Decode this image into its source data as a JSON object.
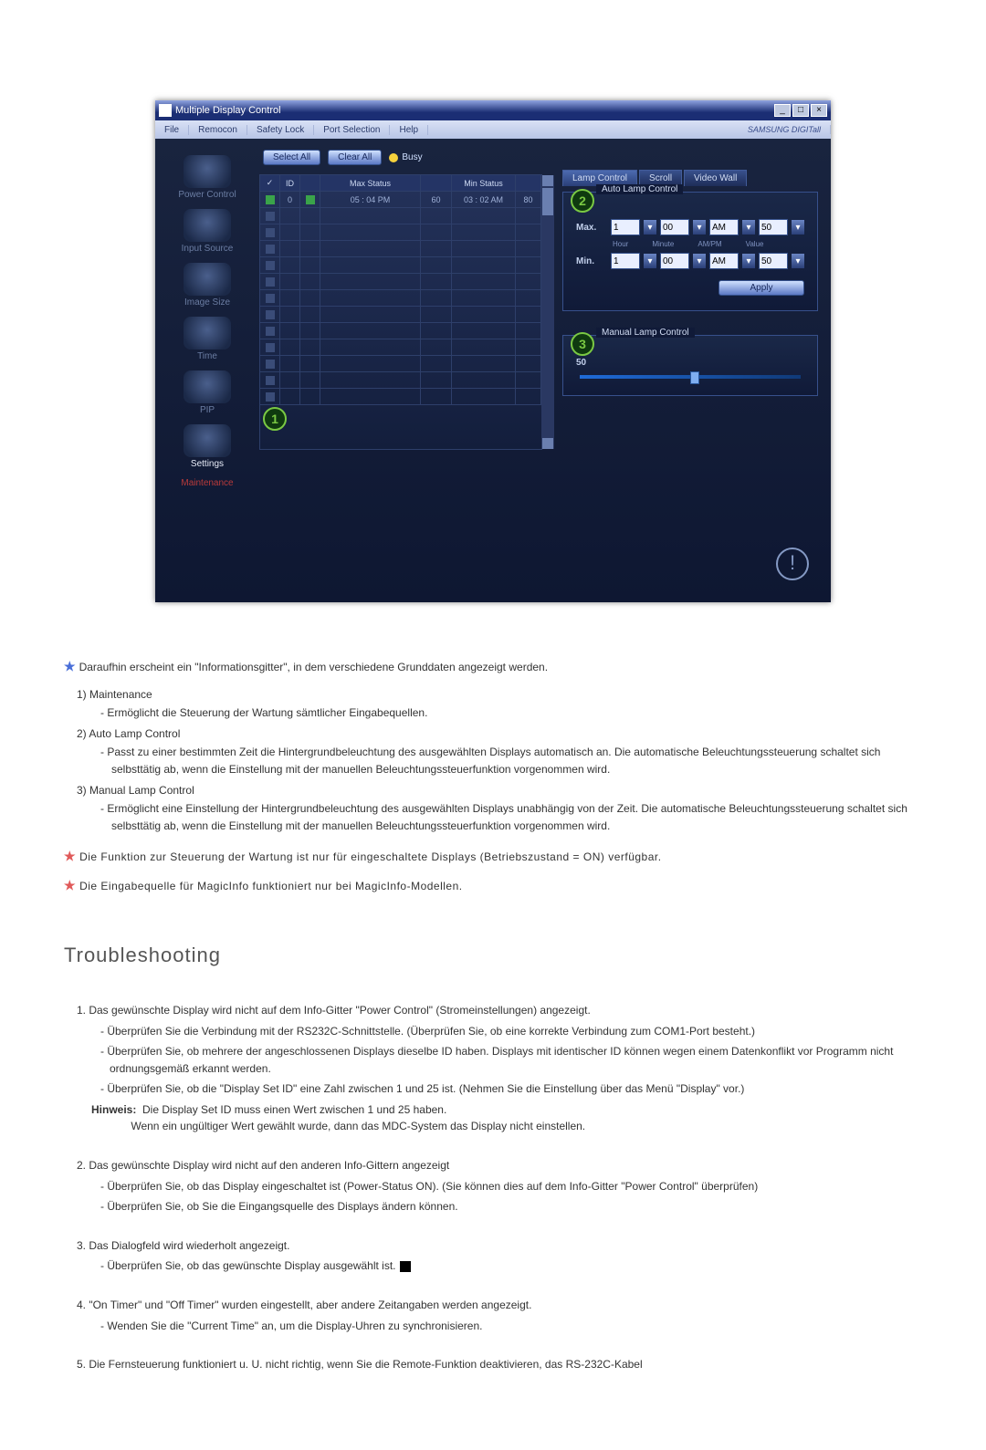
{
  "screenshot": {
    "title": "Multiple Display Control",
    "menus": [
      "File",
      "Remocon",
      "Safety Lock",
      "Port Selection",
      "Help"
    ],
    "brand": "SAMSUNG DIGITall",
    "sidebar": [
      {
        "label": "Power Control"
      },
      {
        "label": "Input Source"
      },
      {
        "label": "Image Size"
      },
      {
        "label": "Time"
      },
      {
        "label": "PIP"
      },
      {
        "label": "Settings"
      },
      {
        "label": "Maintenance"
      }
    ],
    "btn_select_all": "Select All",
    "btn_clear_all": "Clear All",
    "busy": "Busy",
    "table": {
      "headers": [
        "",
        "ID",
        "",
        "Max Status",
        "",
        "Min Status",
        ""
      ],
      "row": {
        "id": "0",
        "max": "05 : 04 PM",
        "maxv": "60",
        "min": "03 : 02 AM",
        "minv": "80"
      }
    },
    "tabs": [
      "Lamp Control",
      "Scroll",
      "Video Wall"
    ],
    "auto_title": "Auto Lamp Control",
    "manual_title": "Manual Lamp Control",
    "max_label": "Max.",
    "min_label": "Min.",
    "col_labels": [
      "Hour",
      "Minute",
      "AM/PM",
      "Value"
    ],
    "auto_row": {
      "hour": "1",
      "minute": "00",
      "ampm": "AM",
      "value": "50"
    },
    "apply": "Apply",
    "manual_value": "50",
    "badge1": "1",
    "badge2": "2",
    "badge3": "3",
    "exclaim": "!"
  },
  "doc": {
    "intro": "Daraufhin erscheint ein \"Informationsgitter\", in dem verschiedene Grunddaten angezeigt werden.",
    "n1_head": "1)  Maintenance",
    "n1_a": "- Ermöglicht die Steuerung der Wartung sämtlicher Eingabequellen.",
    "n2_head": "2)  Auto Lamp Control",
    "n2_a": "- Passt zu einer bestimmten Zeit die Hintergrundbeleuchtung des ausgewählten Displays automatisch an. Die automatische Beleuchtungssteuerung schaltet sich selbsttätig ab, wenn die Einstellung mit der manuellen Beleuchtungssteuerfunktion vorgenommen wird.",
    "n3_head": "3)  Manual Lamp Control",
    "n3_a": "- Ermöglicht eine Einstellung der Hintergrundbeleuchtung des ausgewählten Displays unabhängig von der Zeit. Die automatische Beleuchtungssteuerung schaltet sich selbsttätig ab, wenn die Einstellung mit der manuellen Beleuchtungssteuerfunktion vorgenommen wird.",
    "note1": "Die Funktion zur Steuerung der Wartung ist nur für eingeschaltete Displays (Betriebszustand = ON) verfügbar.",
    "note2": "Die Eingabequelle für MagicInfo funktioniert nur bei MagicInfo-Modellen.",
    "ts_title": "Troubleshooting",
    "t1_head": "1.  Das gewünschte Display wird nicht auf dem Info-Gitter \"Power Control\" (Stromeinstellungen) angezeigt.",
    "t1_a": "- Überprüfen Sie die Verbindung mit der RS232C-Schnittstelle. (Überprüfen Sie, ob eine korrekte Verbindung zum COM1-Port besteht.)",
    "t1_b": "- Überprüfen Sie, ob mehrere der angeschlossenen Displays dieselbe ID haben. Displays mit identischer ID können wegen einem Datenkonflikt vor Programm nicht ordnungsgemäß erkannt werden.",
    "t1_c": "- Überprüfen Sie, ob die \"Display Set ID\" eine Zahl zwischen 1 und 25 ist. (Nehmen Sie die Einstellung über das Menü \"Display\" vor.)",
    "t1_hint_label": "Hinweis:",
    "t1_hint": "  Die Display Set ID muss einen Wert zwischen 1 und 25 haben.\n             Wenn ein ungültiger Wert gewählt wurde, dann das MDC-System das Display nicht einstellen.",
    "t2_head": "2.  Das gewünschte Display wird nicht auf den anderen Info-Gittern angezeigt",
    "t2_a": "- Überprüfen Sie, ob das Display eingeschaltet ist (Power-Status ON). (Sie können dies auf dem Info-Gitter \"Power Control\" überprüfen)",
    "t2_b": "- Überprüfen Sie, ob Sie die Eingangsquelle des Displays ändern können.",
    "t3_head": "3.  Das Dialogfeld wird wiederholt angezeigt.",
    "t3_a": "- Überprüfen Sie, ob das gewünschte Display ausgewählt ist.",
    "t4_head": "4.  \"On Timer\" und \"Off Timer\" wurden eingestellt, aber andere Zeitangaben werden angezeigt.",
    "t4_a": "- Wenden Sie die \"Current Time\" an, um die Display-Uhren zu synchronisieren.",
    "t5_head": "5.  Die Fernsteuerung funktioniert u. U. nicht richtig, wenn Sie die Remote-Funktion deaktivieren, das RS-232C-Kabel"
  }
}
